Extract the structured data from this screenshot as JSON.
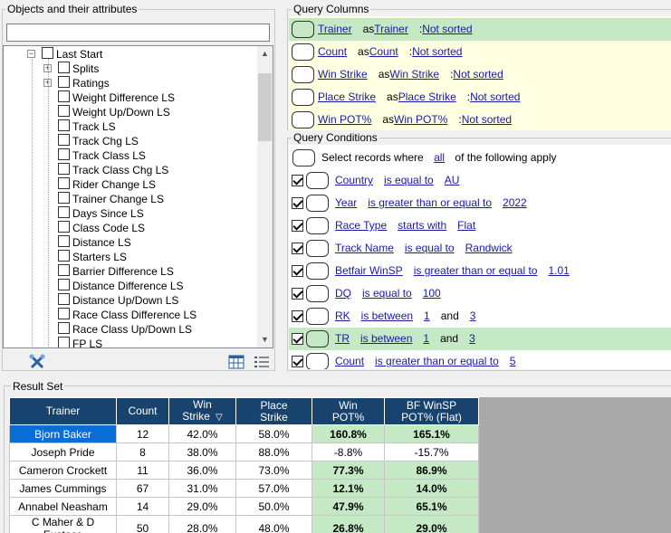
{
  "left_panel": {
    "title": "Objects and their attributes",
    "search": {
      "value": "",
      "placeholder": ""
    },
    "tree": [
      {
        "label": "Last Start",
        "level": 0,
        "expander": "−",
        "checked": false
      },
      {
        "label": "Splits",
        "level": 1,
        "expander": "+",
        "checked": false
      },
      {
        "label": "Ratings",
        "level": 1,
        "expander": "+",
        "checked": false
      },
      {
        "label": "Weight Difference LS",
        "level": 1,
        "checked": false
      },
      {
        "label": "Weight Up/Down LS",
        "level": 1,
        "checked": false
      },
      {
        "label": "Track LS",
        "level": 1,
        "checked": false
      },
      {
        "label": "Track Chg LS",
        "level": 1,
        "checked": false
      },
      {
        "label": "Track Class LS",
        "level": 1,
        "checked": false
      },
      {
        "label": "Track Class Chg LS",
        "level": 1,
        "checked": false
      },
      {
        "label": "Rider Change LS",
        "level": 1,
        "checked": false
      },
      {
        "label": "Trainer Change LS",
        "level": 1,
        "checked": false
      },
      {
        "label": "Days Since LS",
        "level": 1,
        "checked": false
      },
      {
        "label": "Class Code LS",
        "level": 1,
        "checked": false
      },
      {
        "label": "Distance LS",
        "level": 1,
        "checked": false
      },
      {
        "label": "Starters LS",
        "level": 1,
        "checked": false
      },
      {
        "label": "Barrier Difference LS",
        "level": 1,
        "checked": false
      },
      {
        "label": "Distance Difference LS",
        "level": 1,
        "checked": false
      },
      {
        "label": "Distance Up/Down LS",
        "level": 1,
        "checked": false
      },
      {
        "label": "Race Class Difference LS",
        "level": 1,
        "checked": false
      },
      {
        "label": "Race Class Up/Down LS",
        "level": 1,
        "checked": false
      },
      {
        "label": "FP LS",
        "level": 1,
        "checked": false
      }
    ],
    "toolbar": {
      "left_icon": "tools-icon",
      "right_icons": [
        "grid-view-icon",
        "list-view-icon"
      ]
    }
  },
  "query_columns": {
    "title": "Query Columns",
    "rows": [
      {
        "field": "Trainer",
        "as_word": "as",
        "alias": "Trainer",
        "colon": ":",
        "sort": "Not sorted",
        "selected": true
      },
      {
        "field": "Count",
        "as_word": "as",
        "alias": "Count",
        "colon": ":",
        "sort": "Not sorted",
        "selected": false
      },
      {
        "field": "Win Strike",
        "as_word": "as",
        "alias": "Win Strike",
        "colon": ":",
        "sort": "Not sorted",
        "selected": false
      },
      {
        "field": "Place Strike",
        "as_word": "as",
        "alias": "Place Strike",
        "colon": ":",
        "sort": "Not sorted",
        "selected": false
      },
      {
        "field": "Win POT%",
        "as_word": "as",
        "alias": "Win POT%",
        "colon": ":",
        "sort": "Not sorted",
        "selected": false
      }
    ]
  },
  "query_conditions": {
    "title": "Query Conditions",
    "header": {
      "prefix": "Select records where",
      "mode": "all",
      "suffix": "of the following apply"
    },
    "and_word": "and",
    "rows": [
      {
        "field": "Country",
        "op": "is equal to",
        "v1": "AU",
        "v2": "",
        "checked": true,
        "selected": false
      },
      {
        "field": "Year",
        "op": "is greater than or equal to",
        "v1": "2022",
        "v2": "",
        "checked": true,
        "selected": false
      },
      {
        "field": "Race Type",
        "op": "starts with",
        "v1": "Flat",
        "v2": "",
        "checked": true,
        "selected": false
      },
      {
        "field": "Track Name",
        "op": "is equal to",
        "v1": "Randwick",
        "v2": "",
        "checked": true,
        "selected": false
      },
      {
        "field": "Betfair WinSP",
        "op": "is greater than or equal to",
        "v1": "1.01",
        "v2": "",
        "checked": true,
        "selected": false
      },
      {
        "field": "DQ",
        "op": "is equal to",
        "v1": "100",
        "v2": "",
        "checked": true,
        "selected": false
      },
      {
        "field": "RK",
        "op": "is between",
        "v1": "1",
        "v2": "3",
        "checked": true,
        "selected": false
      },
      {
        "field": "TR",
        "op": "is between",
        "v1": "1",
        "v2": "3",
        "checked": true,
        "selected": true
      },
      {
        "field": "Count",
        "op": "is greater than or equal to",
        "v1": "5",
        "v2": "",
        "checked": true,
        "selected": false
      }
    ]
  },
  "result_set": {
    "title": "Result Set",
    "columns": [
      {
        "l1": "Trainer",
        "l2": ""
      },
      {
        "l1": "Count",
        "l2": ""
      },
      {
        "l1": "Win",
        "l2": "Strike",
        "sort_icon": "▽"
      },
      {
        "l1": "Place",
        "l2": "Strike"
      },
      {
        "l1": "Win",
        "l2": "POT%"
      },
      {
        "l1": "BF WinSP",
        "l2": "POT% (Flat)"
      }
    ],
    "rows": [
      {
        "trainer": "Bjorn Baker",
        "count": "12",
        "win_strike": "42.0%",
        "place_strike": "58.0%",
        "win_pot": "160.8%",
        "bf_pot": "165.1%",
        "selected": true,
        "win_pot_pos": true,
        "bf_pot_pos": true
      },
      {
        "trainer": "Joseph Pride",
        "count": "8",
        "win_strike": "38.0%",
        "place_strike": "88.0%",
        "win_pot": "-8.8%",
        "bf_pot": "-15.7%",
        "selected": false,
        "win_pot_pos": false,
        "bf_pot_pos": false
      },
      {
        "trainer": "Cameron Crockett",
        "count": "11",
        "win_strike": "36.0%",
        "place_strike": "73.0%",
        "win_pot": "77.3%",
        "bf_pot": "86.9%",
        "selected": false,
        "win_pot_pos": true,
        "bf_pot_pos": true
      },
      {
        "trainer": "James Cummings",
        "count": "67",
        "win_strike": "31.0%",
        "place_strike": "57.0%",
        "win_pot": "12.1%",
        "bf_pot": "14.0%",
        "selected": false,
        "win_pot_pos": true,
        "bf_pot_pos": true
      },
      {
        "trainer": "Annabel Neasham",
        "count": "14",
        "win_strike": "29.0%",
        "place_strike": "50.0%",
        "win_pot": "47.9%",
        "bf_pot": "65.1%",
        "selected": false,
        "win_pot_pos": true,
        "bf_pot_pos": true
      },
      {
        "trainer": "C Maher & D Eustace",
        "count": "50",
        "win_strike": "28.0%",
        "place_strike": "48.0%",
        "win_pot": "26.8%",
        "bf_pot": "29.0%",
        "selected": false,
        "win_pot_pos": true,
        "bf_pot_pos": true
      }
    ]
  },
  "colors": {
    "header_bg": "#17436e",
    "selected_row": "#c5e8c5",
    "selected_cell": "#0a6ed6",
    "link": "#1a1aa6",
    "columns_bg": "#ffffe1"
  }
}
